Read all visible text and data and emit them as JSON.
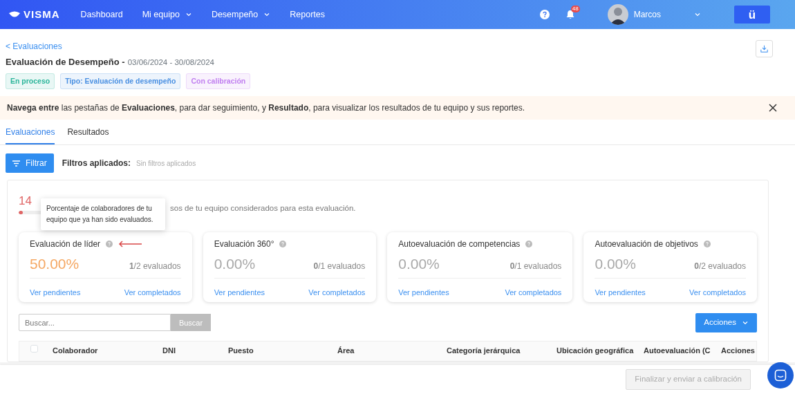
{
  "navbar": {
    "brand": "VISMA",
    "items": [
      {
        "label": "Dashboard",
        "dropdown": false
      },
      {
        "label": "Mi equipo",
        "dropdown": true
      },
      {
        "label": "Desempeño",
        "dropdown": true
      },
      {
        "label": "Reportes",
        "dropdown": false
      }
    ],
    "notifications": "48",
    "user": "Marcos",
    "app_button": "ü"
  },
  "back_link": "< Evaluaciones",
  "title": "Evaluación de Desempeño -",
  "dates": "03/06/2024 - 30/08/2024",
  "tags": [
    {
      "label": "En proceso",
      "color": "#2bb59a"
    },
    {
      "label": "Tipo: Evaluación de desempeño",
      "color": "#4a90e2"
    },
    {
      "label": "Con calibración",
      "color": "#c07ef0"
    }
  ],
  "banner": "**Navega entre** las pestañas de **Evaluaciones**, para dar seguimiento, y **Resultado**, para visualizar los resultados de tu equipo y sus reportes.",
  "tabs": [
    {
      "label": "Evaluaciones",
      "selected": true
    },
    {
      "label": "Resultados",
      "selected": false
    }
  ],
  "filter": {
    "button": "Filtrar",
    "label": "Filtros aplicados:",
    "value": "Sin filtros aplicados"
  },
  "progress": {
    "percent": "14",
    "level": 0.14,
    "subtitle": "sos de tu equipo considerados para esta evaluación."
  },
  "tooltip": "Porcentaje de colaboradores de tu equipo que ya han sido evaluados.",
  "stats": [
    {
      "title": "Evaluación de líder",
      "value": "50.00%",
      "color": "#f5a864",
      "count": "**1**/2 evaluados",
      "arrow": true,
      "pending": "Ver pendientes",
      "completed": "Ver completados"
    },
    {
      "title": "Evaluación 360°",
      "value": "0.00%",
      "color": "#a9a9a9",
      "count": "**0**/1 evaluados",
      "arrow": false,
      "pending": "Ver pendientes",
      "completed": "Ver completados"
    },
    {
      "title": "Autoevaluación de competencias",
      "value": "0.00%",
      "color": "#a9a9a9",
      "count": "**0**/1 evaluados",
      "arrow": false,
      "pending": "Ver pendientes",
      "completed": "Ver completados"
    },
    {
      "title": "Autoevaluación de objetivos",
      "value": "0.00%",
      "color": "#a9a9a9",
      "count": "**0**/2 evaluados",
      "arrow": false,
      "pending": "Ver pendientes",
      "completed": "Ver completados"
    }
  ],
  "search": {
    "placeholder": "Buscar...",
    "button": "Buscar"
  },
  "actions_button": "Acciones",
  "table": {
    "columns": [
      "Colaborador",
      "DNI",
      "Puesto",
      "Área",
      "Categoría jerárquica",
      "Ubicación geográfica",
      "Autoevaluación (C",
      "Acciones"
    ],
    "select_all": false
  },
  "footer_button": {
    "label": "Finalizar y enviar a calibración",
    "disabled": true
  }
}
